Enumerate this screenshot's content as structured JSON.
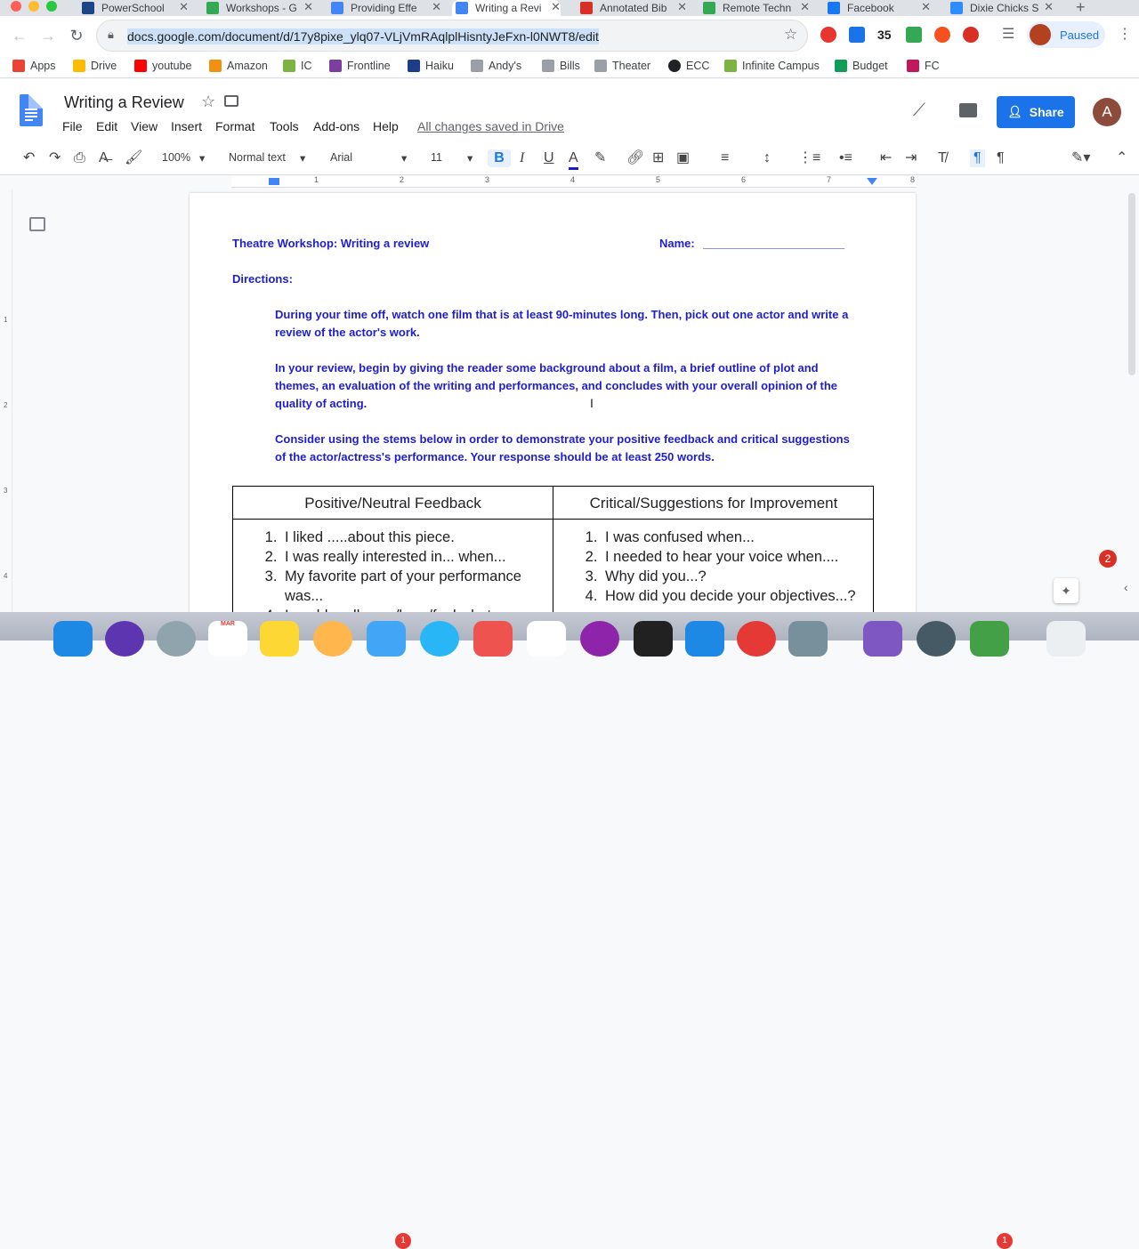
{
  "browser": {
    "tabs": [
      {
        "label": "PowerSchool",
        "color": "#1c4587"
      },
      {
        "label": "Workshops - G",
        "color": "#34a853"
      },
      {
        "label": "Providing Effe",
        "color": "#4285f4"
      },
      {
        "label": "Writing a Revi",
        "color": "#4285f4",
        "active": true
      },
      {
        "label": "Annotated Bib",
        "color": "#d93025"
      },
      {
        "label": "Remote Techn",
        "color": "#34a853"
      },
      {
        "label": "Facebook",
        "color": "#1877f2"
      },
      {
        "label": "Dixie Chicks S",
        "color": "#2d8cff"
      }
    ],
    "tab_close": "✕",
    "new_tab": "+",
    "url": "docs.google.com/document/d/17y8pixe_ylq07-VLjVmRAqlplHisntyJeFxn-l0NWT8/edit",
    "ext_badge": "35",
    "profile_status": "Paused",
    "bookmarks": [
      {
        "label": "Apps",
        "color": "#ea4335"
      },
      {
        "label": "Drive",
        "color": "#fbbc04"
      },
      {
        "label": "youtube",
        "color": "#ff0000"
      },
      {
        "label": "Amazon",
        "color": "#f29111"
      },
      {
        "label": "IC",
        "color": "#7cb342"
      },
      {
        "label": "Frontline",
        "color": "#7b3fa0"
      },
      {
        "label": "Haiku",
        "color": "#1c3d8a"
      },
      {
        "label": "Andy's",
        "color": "#5f6368"
      },
      {
        "label": "Bills",
        "color": "#5f6368"
      },
      {
        "label": "Theater",
        "color": "#5f6368"
      },
      {
        "label": "ECC",
        "color": "#202124"
      },
      {
        "label": "Infinite Campus",
        "color": "#7cb342"
      },
      {
        "label": "Budget",
        "color": "#0f9d58"
      },
      {
        "label": "FC",
        "color": "#c2185b"
      }
    ]
  },
  "docs": {
    "title": "Writing a Review",
    "menus": [
      "File",
      "Edit",
      "View",
      "Insert",
      "Format",
      "Tools",
      "Add-ons",
      "Help"
    ],
    "save_status": "All changes saved in Drive",
    "share_label": "Share",
    "avatar_letter": "A",
    "zoom": "100%",
    "style": "Normal text",
    "font": "Arial",
    "font_size": "11",
    "ruler_numbers": [
      "1",
      "2",
      "3",
      "4",
      "5",
      "6",
      "7",
      "8"
    ],
    "vruler_numbers": [
      "1",
      "2",
      "3",
      "4"
    ],
    "notification_count": "2"
  },
  "document": {
    "heading": "Theatre Workshop: Writing a review",
    "name_label": "Name:",
    "name_line": "______________________",
    "directions_label": "Directions:",
    "paragraphs": [
      "During your time off, watch one film that is at least 90-minutes long. Then, pick out one actor and write a review of the actor's work.",
      "In your review, begin by giving the reader some background about a film, a brief outline of plot and themes, an evaluation of the writing and performances, and concludes with your overall opinion of the quality of acting.",
      "Consider using the stems below in order to demonstrate your positive feedback and critical suggestions of the actor/actress's performance. Your response should be at least 250 words."
    ],
    "table": {
      "left_header": "Positive/Neutral Feedback",
      "right_header": "Critical/Suggestions for Improvement",
      "left_items": [
        "I liked .....about this piece.",
        "I was really interested in... when...",
        "My favorite part of your performance was...",
        "I could really see/hear/feel what..."
      ],
      "right_items": [
        "I was confused when...",
        "I needed to hear your voice when....",
        "Why did you...?",
        "How did you decide your objectives...?"
      ]
    }
  },
  "dock": {
    "calendar_month": "MAR",
    "mail_badge": "1",
    "messages_badge": "1"
  }
}
